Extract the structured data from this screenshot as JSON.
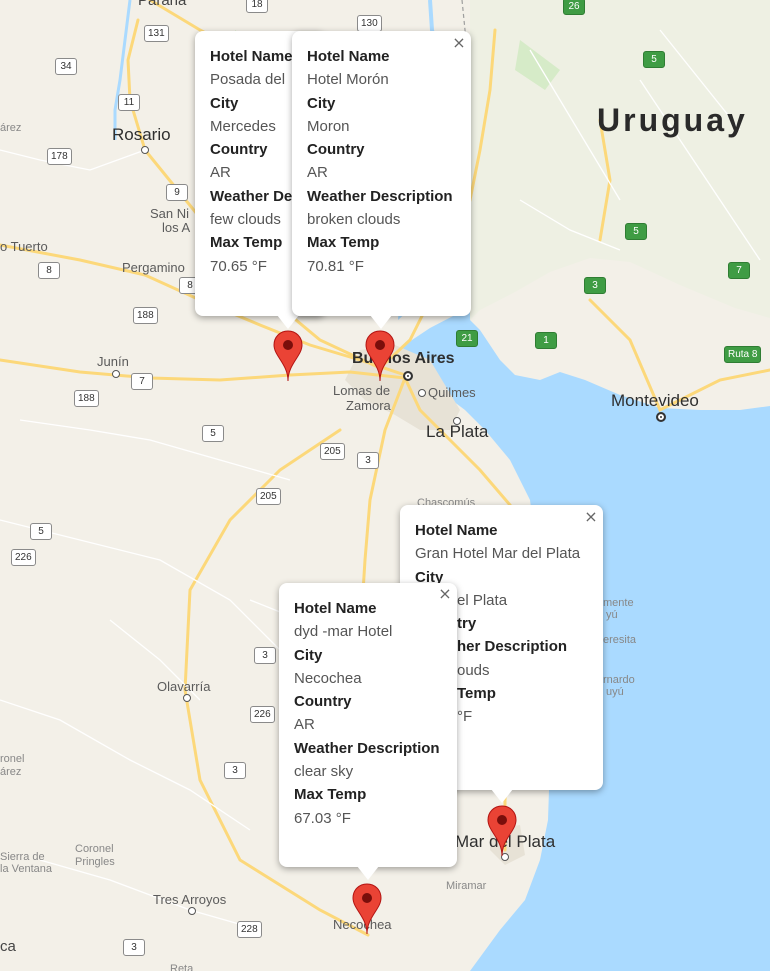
{
  "map": {
    "labels": {
      "parana": "Paraná",
      "rosario": "Rosario",
      "uruguay": "Uruguay",
      "san_nicolas": "San Ni",
      "los_a": "los A",
      "tuerto": "o Tuerto",
      "pergamino": "Pergamino",
      "junin": "Junín",
      "buenos_aires": "Buenos Aires",
      "lomas": "Lomas de",
      "zamora": "Zamora",
      "quilmes": "Quilmes",
      "la_plata": "La Plata",
      "montevideo": "Montevideo",
      "chascomus": "Chascomús",
      "olavarria": "Olavarría",
      "coronel_pringles_1": "Coronel",
      "coronel_pringles_2": "Pringles",
      "sierra_1": "Sierra de",
      "sierra_2": "la Ventana",
      "tres_arroyos": "Tres Arroyos",
      "necochea": "Necochea",
      "mar_del_plata": "Mar del Plata",
      "miramar": "Miramar",
      "rezz": "árez",
      "ronel": "ronel",
      "rez2": "árez",
      "ca": "ca",
      "retz": "Reta",
      "mente": "mente",
      "tyu": "yú",
      "teresita": "eresita",
      "rnardo": "rnardo",
      "uyu": "uyú"
    },
    "shields": {
      "r18": "18",
      "r131": "131",
      "r130": "130",
      "r26": "26",
      "r34": "34",
      "r11": "11",
      "r178": "178",
      "r9": "9",
      "r8a": "8",
      "r8b": "8",
      "r188a": "188",
      "r188b": "188",
      "r7": "7",
      "r5a": "5",
      "r5b": "5",
      "r205a": "205",
      "r205b": "205",
      "r3a": "3",
      "r3b": "3",
      "r3c": "3",
      "r3d": "3",
      "r226a": "226",
      "r226b": "226",
      "r228": "228",
      "r21": "21",
      "g5a": "5",
      "g5b": "5",
      "g7": "7",
      "g3": "3",
      "g1": "1",
      "ruta8": "Ruta 8"
    }
  },
  "popups": [
    {
      "hotel_label": "Hotel Name",
      "hotel": "Posada del",
      "city_label": "City",
      "city": "Mercedes",
      "country_label": "Country",
      "country": "AR",
      "weather_label": "Weather De",
      "weather": "few clouds",
      "temp_label": "Max Temp",
      "temp": "70.65 °F"
    },
    {
      "hotel_label": "Hotel Name",
      "hotel": "Hotel Morón",
      "city_label": "City",
      "city": "Moron",
      "country_label": "Country",
      "country": "AR",
      "weather_label": "Weather Description",
      "weather": "broken clouds",
      "temp_label": "Max Temp",
      "temp": "70.81 °F",
      "close": "×"
    },
    {
      "hotel_label": "Hotel Name",
      "hotel": "Gran Hotel Mar del Plata",
      "city_label": "City",
      "city": "el Plata",
      "country_label": "try",
      "country": "",
      "weather_label": "her Description",
      "weather": "ouds",
      "temp_label": "Temp",
      "temp": "°F",
      "close": "×"
    },
    {
      "hotel_label": "Hotel Name",
      "hotel": "dyd -mar Hotel",
      "city_label": "City",
      "city": "Necochea",
      "country_label": "Country",
      "country": "AR",
      "weather_label": "Weather Description",
      "weather": "clear sky",
      "temp_label": "Max Temp",
      "temp": "67.03 °F",
      "close": "×"
    }
  ],
  "colors": {
    "marker": "#ea4335",
    "marker_dark": "#b31412",
    "water": "#aadaff",
    "land": "#f3f0e8",
    "road": "#fcd87a"
  }
}
